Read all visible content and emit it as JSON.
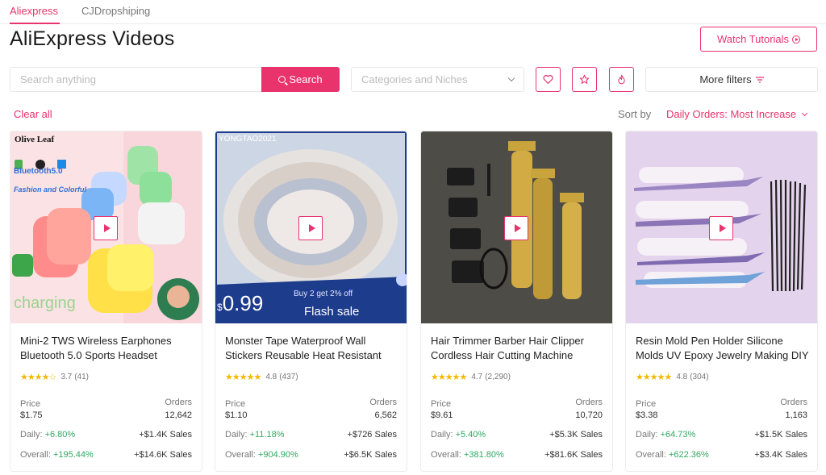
{
  "tabs": [
    {
      "label": "Aliexpress",
      "active": true
    },
    {
      "label": "CJDropshiping",
      "active": false
    }
  ],
  "page_title": "AliExpress Videos",
  "watch_button": {
    "label": "Watch Tutorials",
    "icon": "play-circle-icon"
  },
  "search": {
    "placeholder": "Search anything",
    "button_label": "Search",
    "icon": "search-icon"
  },
  "categories": {
    "placeholder": "Categories and Niches"
  },
  "icon_buttons": [
    "heart-icon",
    "star-icon",
    "fire-icon"
  ],
  "more_filters": {
    "label": "More filters",
    "icon": "filter-lines-icon"
  },
  "clear_all": "Clear all",
  "sort": {
    "label": "Sort by",
    "value": "Daily Orders: Most Increase"
  },
  "labels": {
    "price": "Price",
    "orders": "Orders",
    "daily": "Daily:",
    "overall": "Overall:"
  },
  "colors": {
    "accent": "#e8336d",
    "positive": "#2eaa63",
    "star": "#f5b800"
  },
  "products": [
    {
      "title": "Mini-2 TWS Wireless Earphones Bluetooth 5.0 Sports Headset",
      "stars": "★★★★☆",
      "rating": "3.7",
      "reviews": "(41)",
      "price": "$1.75",
      "orders": "12,642",
      "daily_pct": "+6.80%",
      "daily_sales": "+$1.4K Sales",
      "overall_pct": "+195.44%",
      "overall_sales": "+$14.6K Sales",
      "image_text": {
        "brand": "Olive Leaf",
        "bt": "Bluetooth5.0",
        "tagline": "Fashion and Colorful",
        "charging": "charging"
      }
    },
    {
      "title": "Monster Tape Waterproof Wall Stickers Reusable Heat Resistant",
      "stars": "★★★★★",
      "rating": "4.8",
      "reviews": "(437)",
      "price": "$1.10",
      "orders": "6,562",
      "daily_pct": "+11.18%",
      "daily_sales": "+$726 Sales",
      "overall_pct": "+904.90%",
      "overall_sales": "+$6.5K Sales",
      "image_text": {
        "store": "YONGTAO2021",
        "price": "0.99",
        "currency": "$",
        "promo": "Buy 2 get 2% off",
        "sale": "Flash sale"
      }
    },
    {
      "title": "Hair Trimmer Barber Hair Clipper Cordless Hair Cutting Machine",
      "stars": "★★★★★",
      "rating": "4.7",
      "reviews": "(2,290)",
      "price": "$9.61",
      "orders": "10,720",
      "daily_pct": "+5.40%",
      "daily_sales": "+$5.3K Sales",
      "overall_pct": "+381.80%",
      "overall_sales": "+$81.6K Sales"
    },
    {
      "title": "Resin Mold Pen Holder Silicone Molds UV Epoxy Jewelry Making DIY",
      "stars": "★★★★★",
      "rating": "4.8",
      "reviews": "(304)",
      "price": "$3.38",
      "orders": "1,163",
      "daily_pct": "+64.73%",
      "daily_sales": "+$1.5K Sales",
      "overall_pct": "+622.36%",
      "overall_sales": "+$3.4K Sales"
    }
  ]
}
